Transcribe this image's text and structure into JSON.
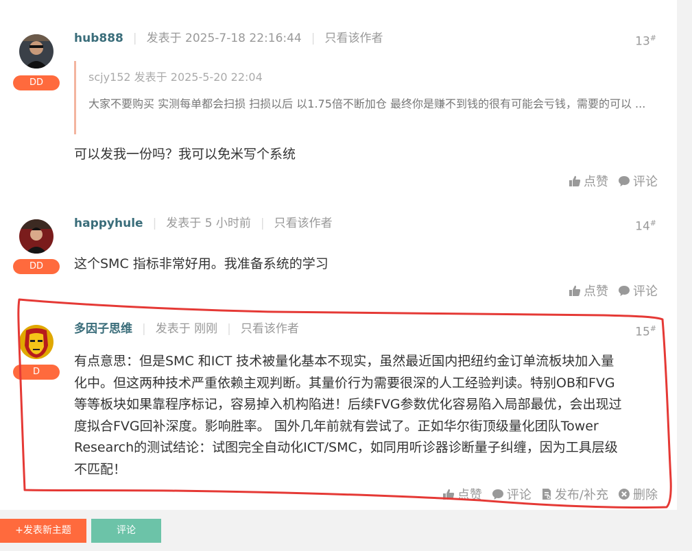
{
  "posts": [
    {
      "author": "hub888",
      "posted": "发表于 2025-7-18 22:16:44",
      "only_author": "只看该作者",
      "floor": "13",
      "floor_mark": "#",
      "badge": "DD",
      "quote": {
        "meta": "scjy152 发表于 2025-5-20 22:04",
        "text": "大家不要购买 实测每单都会扫损 扫损以后 以1.75倍不断加仓 最终你是赚不到钱的很有可能会亏钱，需要的可以 ..."
      },
      "body": "可以发我一份吗？我可以免米写个系统",
      "like": "点赞",
      "comment": "评论"
    },
    {
      "author": "happyhule",
      "posted": "发表于 5 小时前",
      "only_author": "只看该作者",
      "floor": "14",
      "floor_mark": "#",
      "badge": "DD",
      "body": "这个SMC  指标非常好用。我准备系统的学习",
      "like": "点赞",
      "comment": "评论"
    },
    {
      "author": "多因子思维",
      "posted": "发表于 刚刚",
      "only_author": "只看该作者",
      "floor": "15",
      "floor_mark": "#",
      "badge": "D",
      "body_lines": [
        "有点意思：但是SMC 和ICT 技术被量化基本不现实，虽然最近国内把纽约金订单流板块加入量",
        "化中。但这两种技术严重依赖主观判断。其量价行为需要很深的人工经验判读。特别OB和FVG",
        "等等板块如果靠程序标记，容易掉入机构陷进！后续FVG参数优化容易陷入局部最优，会出现过",
        "度拟合FVG回补深度。影响胜率。 国外几年前就有尝试了。正如华尔街顶级量化团队Tower",
        "Research的测试结论：试图完全自动化ICT/SMC，如同用听诊器诊断量子纠缠，因为工具层级",
        "不匹配！"
      ],
      "like": "点赞",
      "comment": "评论",
      "publish": "发布/补充",
      "delete": "删除"
    }
  ],
  "buttons": {
    "new_topic": "+发表新主题",
    "reply": "评论"
  },
  "colors": {
    "badge": "#ff6a3d",
    "author": "#3a6d7a",
    "new_topic_btn": "#ff6a3d",
    "reply_btn": "#6cc3a8",
    "annotation": "#e53935"
  }
}
